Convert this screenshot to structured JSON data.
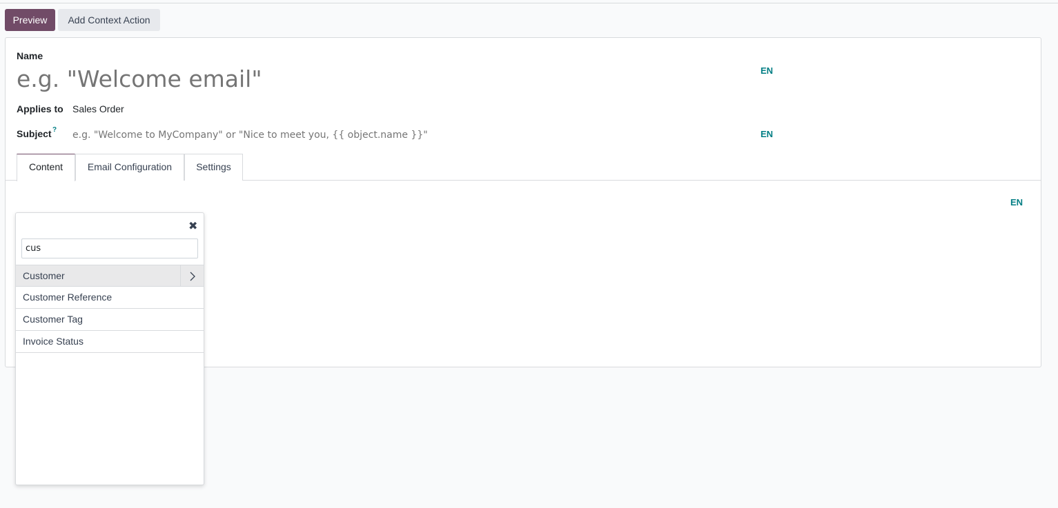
{
  "toolbar": {
    "preview_label": "Preview",
    "context_action_label": "Add Context Action"
  },
  "form": {
    "name_label": "Name",
    "name_placeholder": "e.g. \"Welcome email\"",
    "lang_code": "EN",
    "applies_label": "Applies to",
    "applies_value": "Sales Order",
    "subject_label": "Subject",
    "subject_help": "?",
    "subject_placeholder": "e.g. \"Welcome to MyCompany\" or \"Nice to meet you, {{ object.name }}\""
  },
  "tabs": [
    {
      "label": "Content",
      "active": true
    },
    {
      "label": "Email Configuration",
      "active": false
    },
    {
      "label": "Settings",
      "active": false
    }
  ],
  "field_selector": {
    "close_glyph": "✖",
    "search_value": "cus",
    "items": [
      {
        "label": "Customer",
        "has_children": true
      },
      {
        "label": "Customer Reference",
        "has_children": false
      },
      {
        "label": "Customer Tag",
        "has_children": false
      },
      {
        "label": "Invoice Status",
        "has_children": false
      }
    ]
  },
  "colors": {
    "primary": "#714b67",
    "accent": "#017e84"
  }
}
